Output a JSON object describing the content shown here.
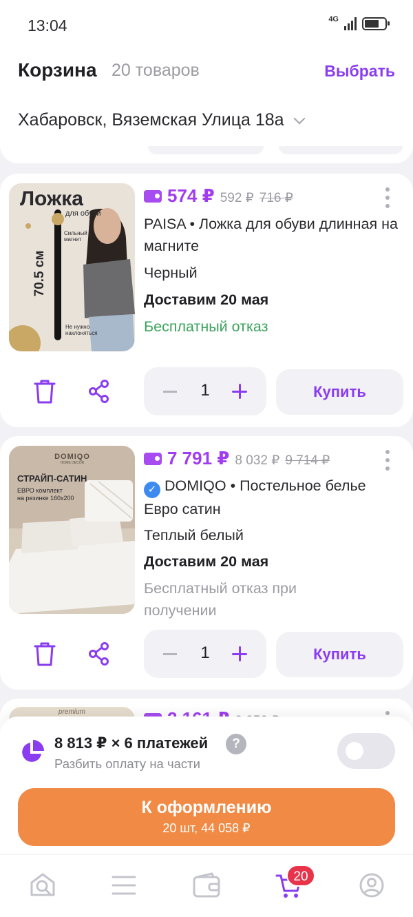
{
  "status_bar": {
    "time": "13:04",
    "network": "4G"
  },
  "header": {
    "title": "Корзина",
    "count": "20 товаров",
    "select_label": "Выбрать",
    "address": "Хабаровск, Вяземская Улица 18а"
  },
  "items": [
    {
      "price": "574 ₽",
      "price_old": "592 ₽",
      "price_crossed": "716 ₽",
      "title": "PAISA • Ложка для обуви длинная на магните",
      "variant": "Черный",
      "delivery": "Доставим 20 мая",
      "refund": "Бесплатный отказ",
      "quantity": "1",
      "buy_label": "Купить",
      "image": {
        "headline": "Ложка",
        "subline": "для обуви",
        "size": "70.5 см",
        "feature1_a": "Сильный",
        "feature1_b": "магнит",
        "feature2_a": "Не нужно",
        "feature2_b": "наклоняться"
      }
    },
    {
      "price": "7 791 ₽",
      "price_old": "8 032 ₽",
      "price_crossed": "9 714 ₽",
      "brand": "DOMIQO",
      "title_rest": " • Постельное белье Евро сатин",
      "variant": "Теплый белый",
      "delivery": "Доставим 20 мая",
      "refund": "Бесплатный отказ при получении",
      "quantity": "1",
      "buy_label": "Купить",
      "image": {
        "logo": "DOMIQO",
        "logo_sub": "HOME DECOR",
        "headline": "СТРАЙП-САТИН",
        "line1": "ЕВРО комплект",
        "line2": "на резинке 160х200"
      }
    },
    {
      "price": "2 161 ₽",
      "price_old": "2 250 ₽",
      "image": {
        "label": "premium"
      }
    }
  ],
  "checkout": {
    "split_title": "8 813 ₽ × 6 платежей",
    "help": "?",
    "split_subtitle": "Разбить оплату на части",
    "button_label": "К оформлению",
    "button_sub": "20 шт, 44 058 ₽"
  },
  "bottom_nav": {
    "cart_badge": "20"
  },
  "colors": {
    "accent": "#8a3cf0",
    "price": "#a13cf0",
    "checkout": "#f08a45",
    "badge": "#e8344b",
    "refund_green": "#3aa35c"
  }
}
